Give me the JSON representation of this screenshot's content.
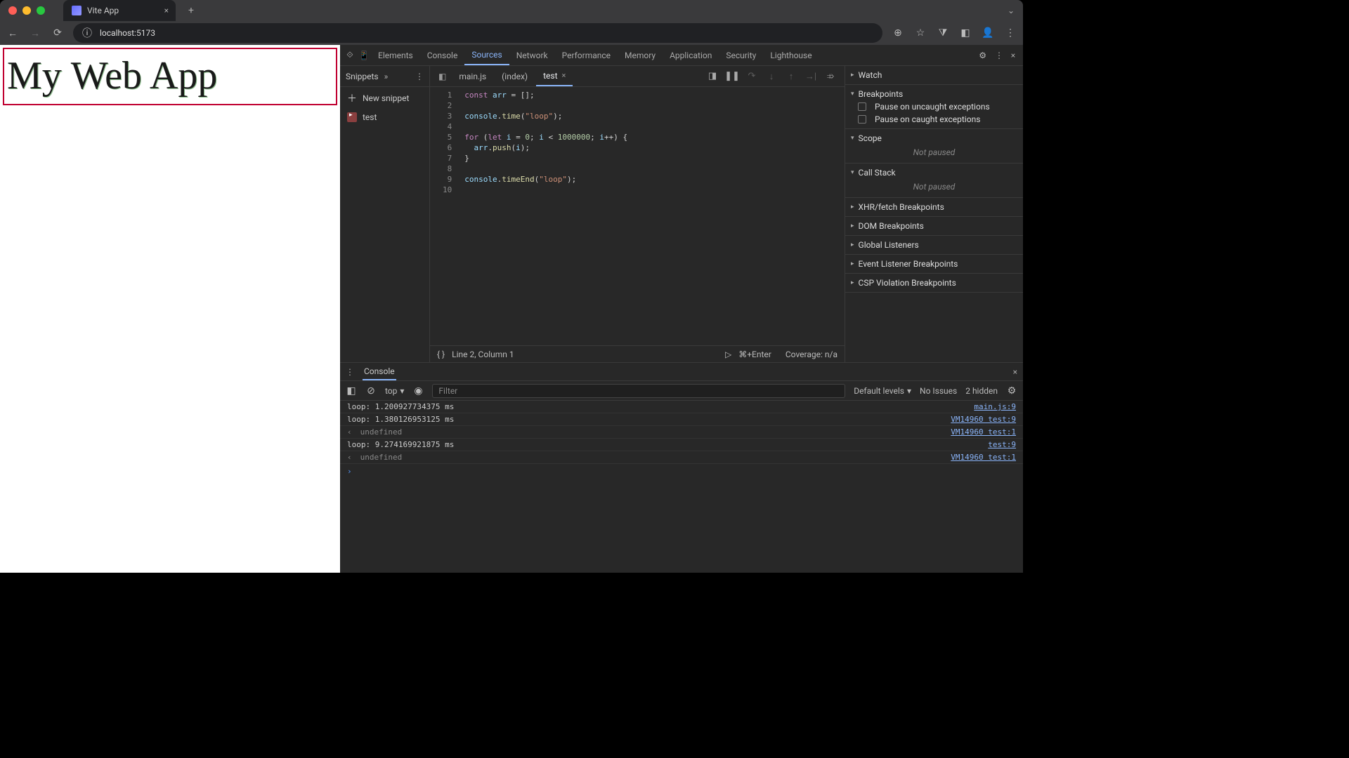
{
  "browser": {
    "tab_title": "Vite App",
    "url": "localhost:5173"
  },
  "page": {
    "heading": "My Web App"
  },
  "devtools": {
    "tabs": [
      "Elements",
      "Console",
      "Sources",
      "Network",
      "Performance",
      "Memory",
      "Application",
      "Security",
      "Lighthouse"
    ],
    "active_tab": "Sources"
  },
  "sources": {
    "sidebar_label": "Snippets",
    "new_snippet_label": "New snippet",
    "files": [
      "test"
    ],
    "editor_tabs": [
      {
        "name": "main.js",
        "active": false
      },
      {
        "name": "(index)",
        "active": false
      },
      {
        "name": "test",
        "active": true
      }
    ],
    "code_lines": [
      {
        "n": 1,
        "html": "<span class='kw'>const</span> <span class='id'>arr</span> = [];"
      },
      {
        "n": 2,
        "html": ""
      },
      {
        "n": 3,
        "html": "<span class='id'>console</span>.<span class='fn'>time</span>(<span class='str'>\"loop\"</span>);"
      },
      {
        "n": 4,
        "html": ""
      },
      {
        "n": 5,
        "html": "<span class='kw'>for</span> (<span class='kw'>let</span> <span class='id'>i</span> = <span class='num'>0</span>; <span class='id'>i</span> &lt; <span class='num'>1000000</span>; <span class='id'>i</span>++) {"
      },
      {
        "n": 6,
        "html": "  <span class='id'>arr</span>.<span class='fn'>push</span>(<span class='id'>i</span>);"
      },
      {
        "n": 7,
        "html": "}"
      },
      {
        "n": 8,
        "html": ""
      },
      {
        "n": 9,
        "html": "<span class='id'>console</span>.<span class='fn'>timeEnd</span>(<span class='str'>\"loop\"</span>);"
      },
      {
        "n": 10,
        "html": ""
      }
    ],
    "status_pos": "Line 2, Column 1",
    "status_run": "⌘+Enter",
    "status_cov": "Coverage: n/a"
  },
  "debug": {
    "watch": "Watch",
    "breakpoints": "Breakpoints",
    "uncaught": "Pause on uncaught exceptions",
    "caught": "Pause on caught exceptions",
    "scope": "Scope",
    "callstack": "Call Stack",
    "not_paused": "Not paused",
    "xhr": "XHR/fetch Breakpoints",
    "dom": "DOM Breakpoints",
    "gl": "Global Listeners",
    "el": "Event Listener Breakpoints",
    "csp": "CSP Violation Breakpoints"
  },
  "console": {
    "tab_label": "Console",
    "context": "top",
    "filter_placeholder": "Filter",
    "levels": "Default levels",
    "issues": "No Issues",
    "hidden": "2 hidden",
    "logs": [
      {
        "msg": "loop: 1.200927734375 ms",
        "src": "main.js:9"
      },
      {
        "msg": "loop: 1.380126953125 ms",
        "src": "VM14960 test:9"
      },
      {
        "ret": true,
        "msg": "undefined",
        "src": "VM14960 test:1"
      },
      {
        "msg": "loop: 9.274169921875 ms",
        "src": "test:9"
      },
      {
        "ret": true,
        "msg": "undefined",
        "src": "VM14960 test:1"
      }
    ]
  }
}
